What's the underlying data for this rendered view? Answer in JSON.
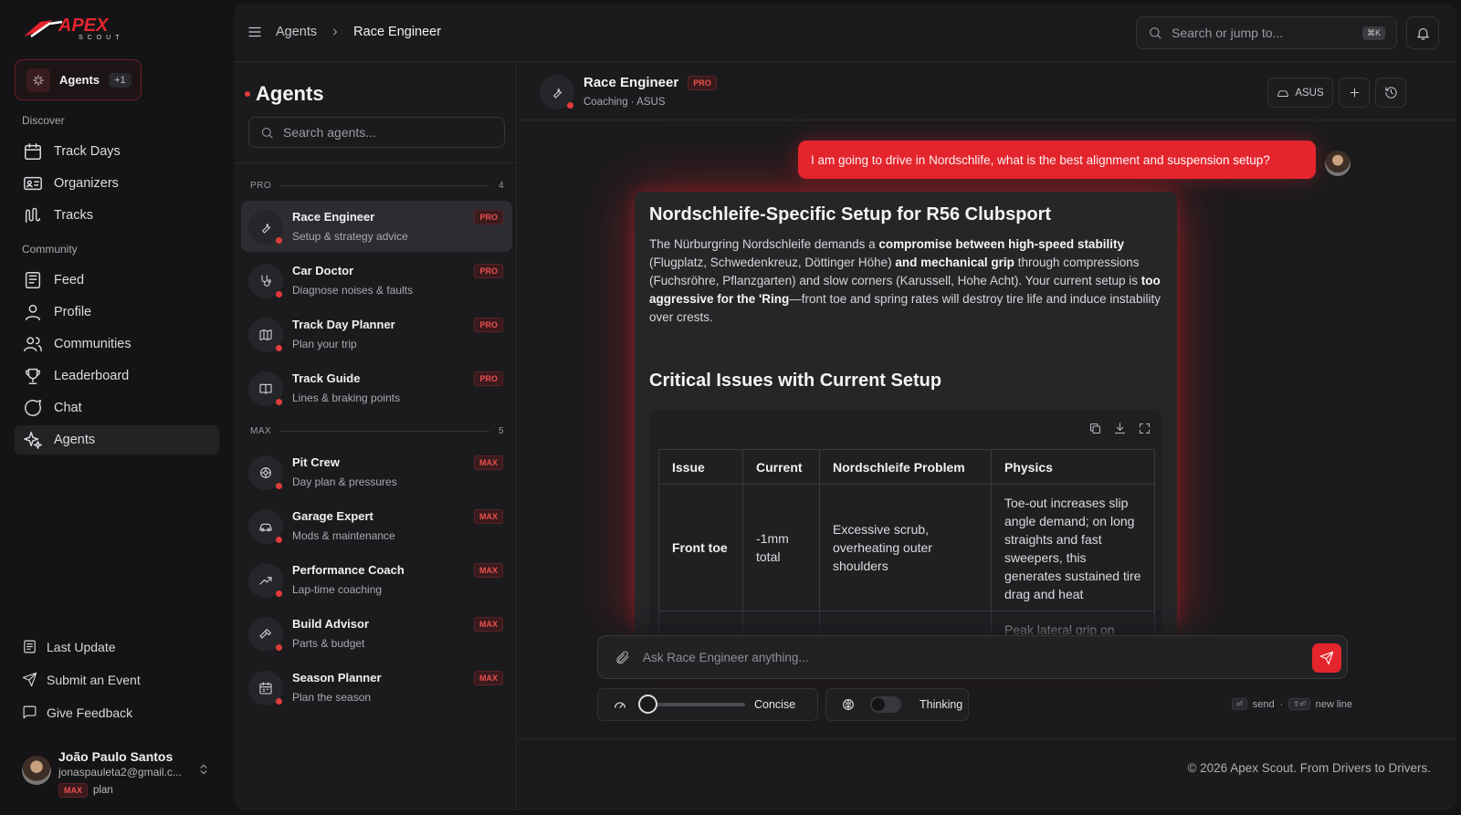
{
  "brand": {
    "logo_main": "APEX",
    "logo_sub": "SCOUT"
  },
  "nav": {
    "pill": {
      "label": "Agents",
      "count": "+1"
    },
    "sections": {
      "discover": "Discover",
      "community": "Community"
    },
    "discover_items": [
      "Track Days",
      "Organizers",
      "Tracks"
    ],
    "community_items": [
      "Feed",
      "Profile",
      "Communities",
      "Leaderboard",
      "Chat",
      "Agents"
    ],
    "bottom_items": [
      "Last Update",
      "Submit an Event",
      "Give Feedback"
    ],
    "user": {
      "name": "João Paulo Santos",
      "email": "jonaspauleta2@gmail.c...",
      "plan_badge": "MAX",
      "plan_word": "plan"
    }
  },
  "topbar": {
    "breadcrumb": [
      "Agents",
      "Race Engineer"
    ],
    "search_placeholder": "Search or jump to...",
    "search_shortcut": "⌘K"
  },
  "agents_panel": {
    "title": "Agents",
    "search_placeholder": "Search agents...",
    "groups": [
      {
        "name": "PRO",
        "count": "4",
        "agents": [
          {
            "name": "Race Engineer",
            "desc": "Setup & strategy advice",
            "badge": "PRO",
            "icon": "wrench-icon"
          },
          {
            "name": "Car Doctor",
            "desc": "Diagnose noises & faults",
            "badge": "PRO",
            "icon": "stethoscope-icon"
          },
          {
            "name": "Track Day Planner",
            "desc": "Plan your trip",
            "badge": "PRO",
            "icon": "map-icon"
          },
          {
            "name": "Track Guide",
            "desc": "Lines & braking points",
            "badge": "PRO",
            "icon": "book-icon"
          }
        ]
      },
      {
        "name": "MAX",
        "count": "5",
        "agents": [
          {
            "name": "Pit Crew",
            "desc": "Day plan & pressures",
            "badge": "MAX",
            "icon": "tire-icon"
          },
          {
            "name": "Garage Expert",
            "desc": "Mods & maintenance",
            "badge": "MAX",
            "icon": "car-icon"
          },
          {
            "name": "Performance Coach",
            "desc": "Lap-time coaching",
            "badge": "MAX",
            "icon": "trend-up-icon"
          },
          {
            "name": "Build Advisor",
            "desc": "Parts & budget",
            "badge": "MAX",
            "icon": "hammer-icon"
          },
          {
            "name": "Season Planner",
            "desc": "Plan the season",
            "badge": "MAX",
            "icon": "calendar-icon"
          }
        ]
      }
    ]
  },
  "chat": {
    "agent_name": "Race Engineer",
    "agent_badge": "PRO",
    "agent_subtitle": "Coaching · ASUS",
    "car_button": "ASUS",
    "user_message": "I am going to drive in Nordschlife, what is the best alignment and suspension setup?",
    "response": {
      "title": "Nordschleife-Specific Setup for R56 Clubsport",
      "para_parts": [
        "The Nürburgring Nordschleife demands a ",
        "compromise between high-speed stability",
        " (Flugplatz, Schwedenkreuz, Döttinger Höhe) ",
        "and mechanical grip",
        " through compressions (Fuchsröhre, Pflanzgarten) and slow corners (Karussell, Hohe Acht). Your current setup is ",
        "too aggressive for the 'Ring",
        "—front toe and spring rates will destroy tire life and induce instability over crests."
      ],
      "section_title": "Critical Issues with Current Setup",
      "table": {
        "headers": [
          "Issue",
          "Current",
          "Nordschleife Problem",
          "Physics"
        ],
        "rows": [
          [
            "Front toe",
            "-1mm total",
            "Excessive scrub, overheating outer shoulders",
            "Toe-out increases slip angle demand; on long straights and fast sweepers, this generates sustained tire drag and heat"
          ],
          [
            "",
            "",
            "",
            "Peak lateral grip on"
          ]
        ]
      }
    },
    "composer_placeholder": "Ask Race Engineer anything...",
    "verbosity_label": "Concise",
    "verbosity_level": 0,
    "thinking_label": "Thinking",
    "thinking_on": false,
    "hint_send": "send",
    "hint_newline": "new line",
    "footer": "© 2026 Apex Scout. From Drivers to Drivers."
  },
  "colors": {
    "accent": "#e5252d",
    "background": "#141416",
    "panel": "#1b1b1e"
  }
}
